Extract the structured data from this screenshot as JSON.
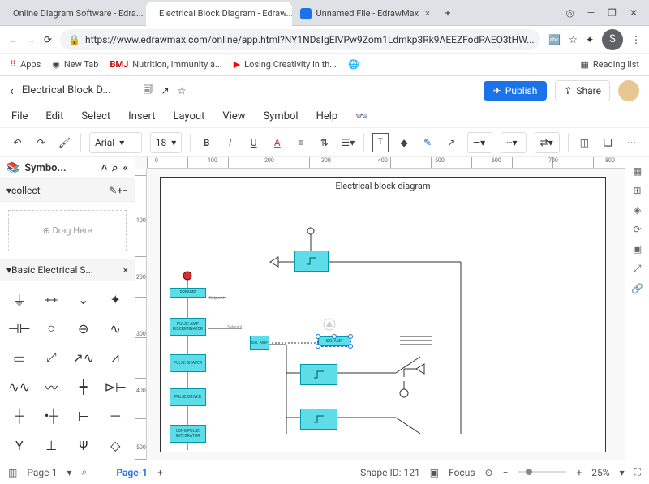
{
  "tabs": [
    {
      "label": "Online Diagram Software - Edra..."
    },
    {
      "label": "Electrical Block Diagram - Edraw..."
    },
    {
      "label": "Unnamed File - EdrawMax"
    }
  ],
  "win_buttons": {
    "target": "◎",
    "min": "—",
    "max": "❐",
    "close": "✕"
  },
  "nav": {
    "back": "←",
    "forward": "→",
    "reload": "⟳"
  },
  "url_lock": "🔒",
  "url": "https://www.edrawmax.com/online/app.html?NY1NDsIgEIVPw9Zom1Ldmkp3Rk9AEEZFodPAEO3tHW...",
  "url_right": {
    "translate": "⋮",
    "star": "☆",
    "ext": "✦",
    "avatar": "S",
    "menu": "⋮"
  },
  "bookmarks": {
    "apps": "Apps",
    "newtab": "New Tab",
    "bmj": "BMJ",
    "nutrition": "Nutrition, immunity a...",
    "yt": "Losing Creativity in th...",
    "reading": "Reading list"
  },
  "app": {
    "back": "‹",
    "title": "Electrical Block D...",
    "publish": "Publish",
    "share": "Share"
  },
  "menu": [
    "File",
    "Edit",
    "Select",
    "Insert",
    "Layout",
    "View",
    "Symbol",
    "Help"
  ],
  "toolbar": {
    "font": "Arial",
    "size": "18"
  },
  "panel": {
    "title": "Symbo...",
    "collect": "collect",
    "drag": "⊕  Drag Here",
    "basic": "Basic Electrical S..."
  },
  "canvas": {
    "title": "Electrical block diagram"
  },
  "blocks": {
    "preamp": "PREAMP",
    "setpoint1": "Setpoint",
    "pulseamp": "PULSE AMP DISCRIMINATOR",
    "setpoint2": "Setpoint",
    "isoamp1": "ISO. AMP",
    "isoamp2": "ISO. AMP",
    "pulseshaper": "PULSE SHAPER",
    "pulsedriver": "PULSE DRIVER",
    "integrator": "LONG PULSE INTEGRATOR"
  },
  "ruler_h": [
    "0",
    "100",
    "200",
    "300",
    "400",
    "500",
    "600",
    "700",
    "800"
  ],
  "ruler_v": [
    "100",
    "200",
    "300",
    "400",
    "500"
  ],
  "status": {
    "page": "Page-1",
    "page_active": "Page-1",
    "shape": "Shape ID: 121",
    "focus": "Focus",
    "zoom": "25%"
  }
}
